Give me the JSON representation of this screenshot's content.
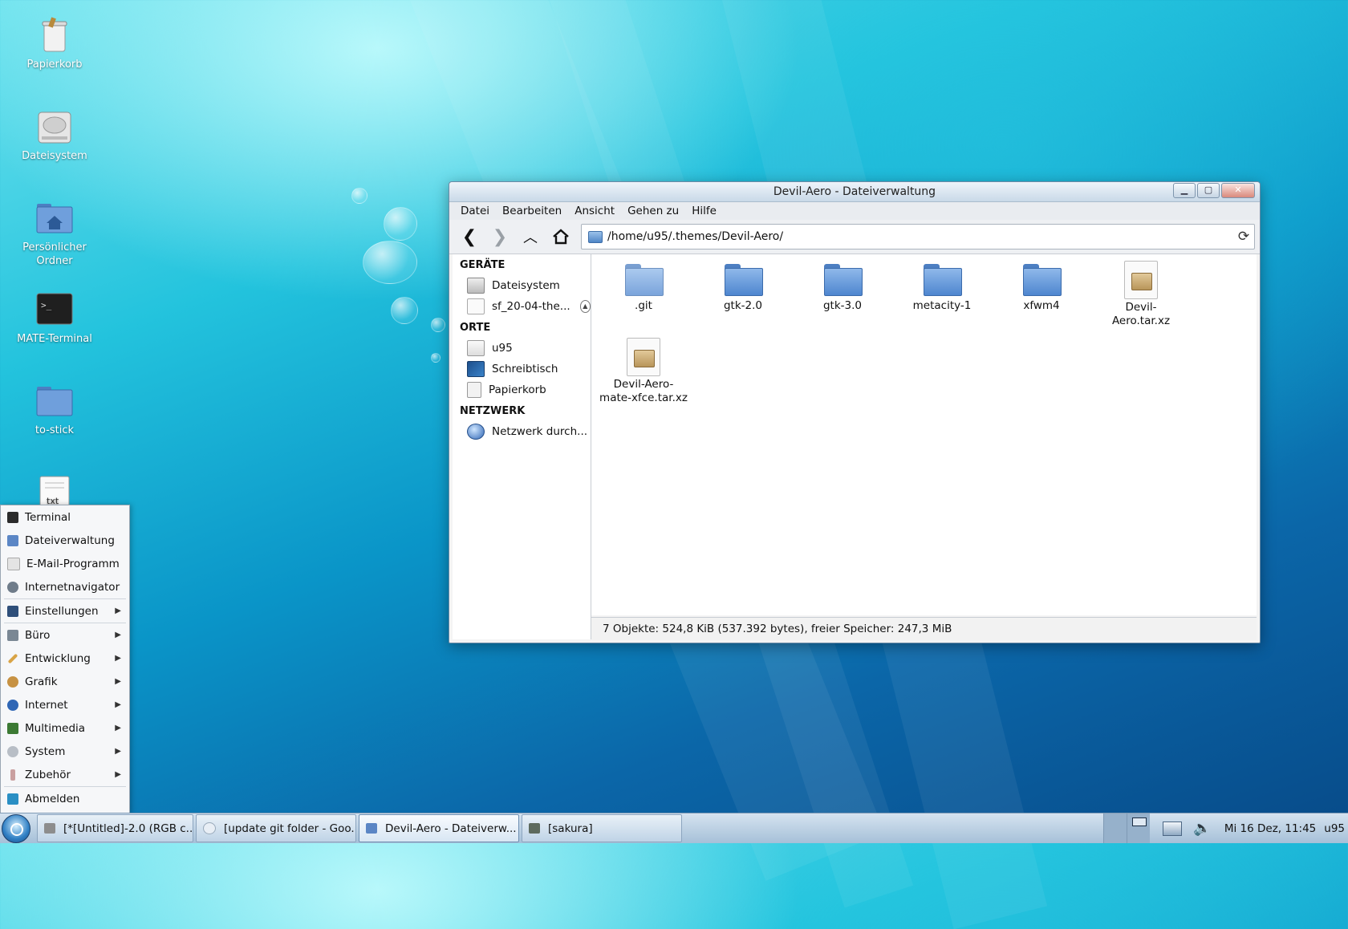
{
  "desktop": {
    "icons": [
      {
        "label": "Papierkorb",
        "icon": "trash-icon"
      },
      {
        "label": "Dateisystem",
        "icon": "harddisk-icon"
      },
      {
        "label": "Persönlicher Ordner",
        "icon": "home-folder-icon"
      },
      {
        "label": "MATE-Terminal",
        "icon": "terminal-icon"
      },
      {
        "label": "to-stick",
        "icon": "folder-icon"
      },
      {
        "label": "txt",
        "icon": "text-file-icon"
      }
    ]
  },
  "window": {
    "title": "Devil-Aero - Dateiverwaltung",
    "menu": [
      "Datei",
      "Bearbeiten",
      "Ansicht",
      "Gehen zu",
      "Hilfe"
    ],
    "location": "/home/u95/.themes/Devil-Aero/",
    "sidebar": {
      "devices_header": "GERÄTE",
      "devices": [
        {
          "label": "Dateisystem",
          "icon": "harddisk-icon"
        },
        {
          "label": "sf_20-04-the...",
          "icon": "drive-icon"
        }
      ],
      "places_header": "ORTE",
      "places": [
        {
          "label": "u95",
          "icon": "home-icon"
        },
        {
          "label": "Schreibtisch",
          "icon": "desktop-icon"
        },
        {
          "label": "Papierkorb",
          "icon": "trash-icon"
        }
      ],
      "network_header": "NETZWERK",
      "network": [
        {
          "label": "Netzwerk durch...",
          "icon": "network-icon"
        }
      ]
    },
    "files": [
      {
        "name": ".git",
        "type": "folder"
      },
      {
        "name": "gtk-2.0",
        "type": "folder"
      },
      {
        "name": "gtk-3.0",
        "type": "folder"
      },
      {
        "name": "metacity-1",
        "type": "folder"
      },
      {
        "name": "xfwm4",
        "type": "folder"
      },
      {
        "name_line1": "Devil-",
        "name_line2": "Aero.tar.xz",
        "type": "archive"
      },
      {
        "name_line1": "Devil-Aero-",
        "name_line2": "mate-xfce.tar.xz",
        "type": "archive"
      }
    ],
    "status": "7 Objekte: 524,8 KiB (537.392 bytes), freier Speicher: 247,3 MiB"
  },
  "start_menu": {
    "items": [
      {
        "label": "Terminal",
        "color": "#2b2b2b"
      },
      {
        "label": "Dateiverwaltung",
        "color": "#5b86c5"
      },
      {
        "label": "E-Mail-Programm",
        "color": "#c9c9c9"
      },
      {
        "label": "Internetnavigator",
        "color": "#6f7c8a"
      },
      {
        "label": "Einstellungen",
        "color": "#2f4f7a",
        "submenu": true
      },
      {
        "label": "Büro",
        "color": "#7a8794",
        "submenu": true
      },
      {
        "label": "Entwicklung",
        "color": "#d9a446",
        "submenu": true
      },
      {
        "label": "Grafik",
        "color": "#c79243",
        "submenu": true
      },
      {
        "label": "Internet",
        "color": "#2f66b5",
        "submenu": true
      },
      {
        "label": "Multimedia",
        "color": "#3c7a34",
        "submenu": true
      },
      {
        "label": "System",
        "color": "#b8bec6",
        "submenu": true
      },
      {
        "label": "Zubehör",
        "color": "#c9a0a0",
        "submenu": true
      },
      {
        "label": "Abmelden",
        "color": "#2a8fc4"
      }
    ]
  },
  "taskbar": {
    "tasks": [
      {
        "label": "[*[Untitled]-2.0 (RGB c...",
        "icon": "gimp-icon",
        "active": false
      },
      {
        "label": "[update git folder - Goo...",
        "icon": "browser-icon",
        "active": false
      },
      {
        "label": "Devil-Aero - Dateiverw...",
        "icon": "folder-icon",
        "active": true
      },
      {
        "label": "[sakura]",
        "icon": "terminal-icon",
        "active": false
      }
    ],
    "clock": "Mi 16 Dez, 11:45",
    "user": "u95"
  }
}
